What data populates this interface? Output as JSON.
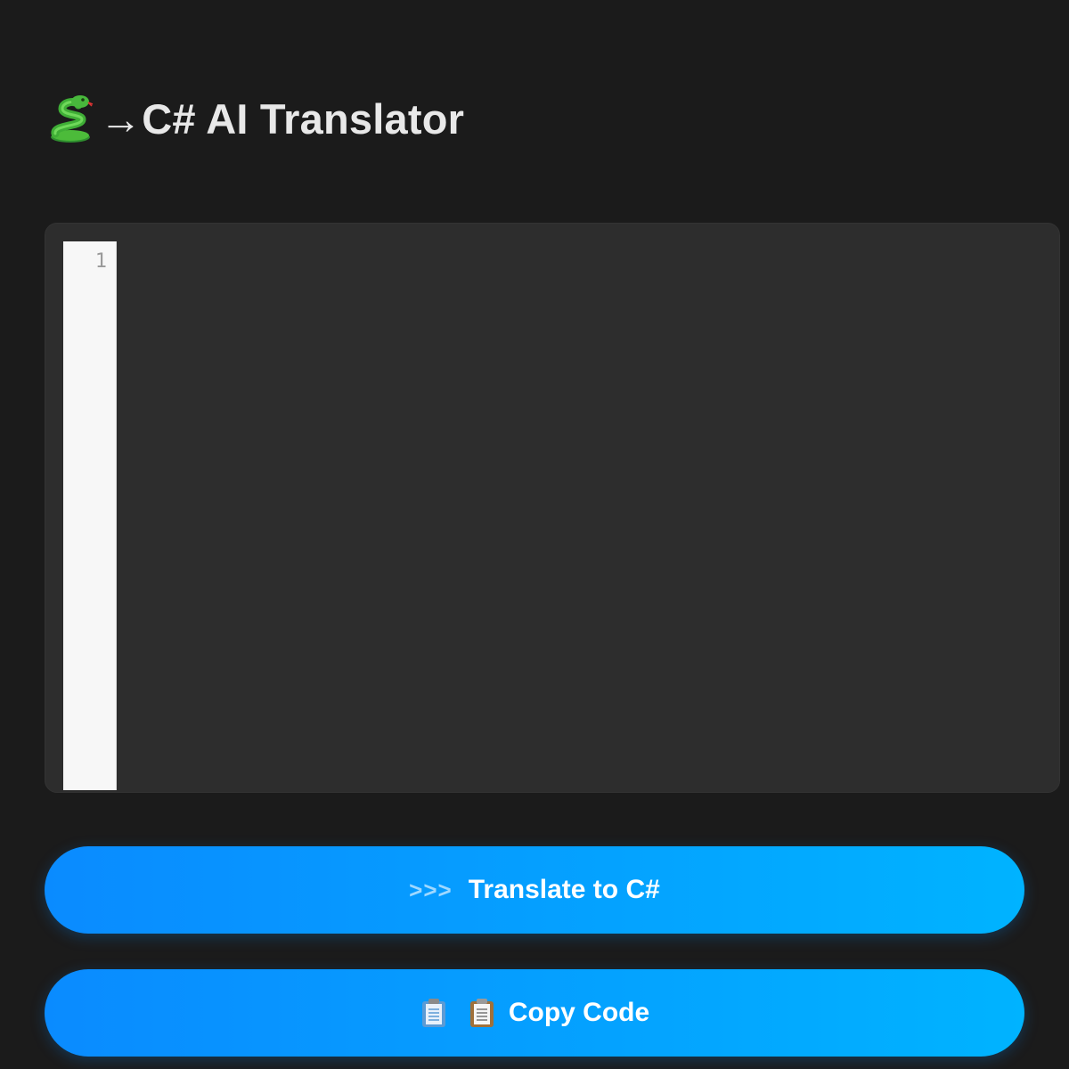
{
  "app": {
    "title_icon": "snake-icon",
    "title": "→C# AI Translator"
  },
  "editor": {
    "line_numbers": [
      "1"
    ],
    "content": ""
  },
  "buttons": {
    "translate": {
      "prefix": ">>>",
      "label": "Translate to C#"
    },
    "copy": {
      "icons": [
        "clipboard-icon",
        "clipboard-icon"
      ],
      "label": "Copy Code"
    }
  },
  "colors": {
    "background": "#1b1b1b",
    "editor_background": "#2d2d2d",
    "gutter_background": "#f7f7f7",
    "button_gradient_start": "#0a8bff",
    "button_gradient_end": "#00b3ff"
  }
}
